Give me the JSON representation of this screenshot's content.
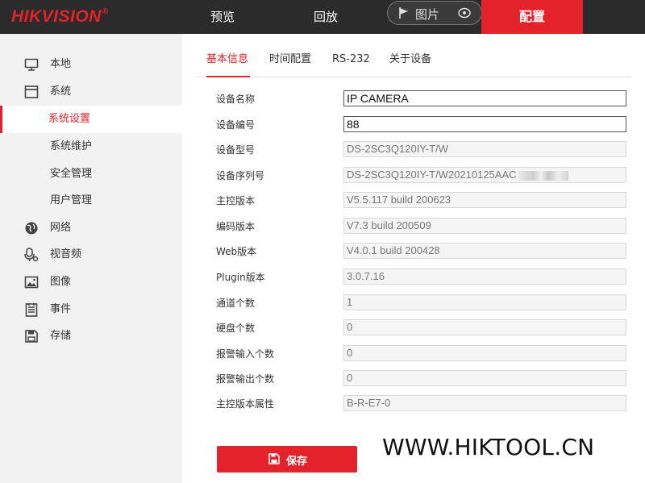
{
  "brand": {
    "logo_text": "HIKVISION",
    "reg_mark": "®"
  },
  "topnav": {
    "preview": "预览",
    "playback": "回放",
    "picture": "图片",
    "config": "配置"
  },
  "sidebar": {
    "items": [
      {
        "label": "本地",
        "icon": "monitor-icon"
      },
      {
        "label": "系统",
        "icon": "system-window-icon"
      },
      {
        "label": "系统设置",
        "active": true
      },
      {
        "label": "系统维护"
      },
      {
        "label": "安全管理"
      },
      {
        "label": "用户管理"
      },
      {
        "label": "网络",
        "icon": "globe-icon"
      },
      {
        "label": "视音频",
        "icon": "microphone-icon"
      },
      {
        "label": "图像",
        "icon": "image-icon"
      },
      {
        "label": "事件",
        "icon": "event-list-icon"
      },
      {
        "label": "存储",
        "icon": "save-disk-icon"
      }
    ]
  },
  "tabs": [
    {
      "label": "基本信息",
      "active": true
    },
    {
      "label": "时间配置"
    },
    {
      "label": "RS-232"
    },
    {
      "label": "关于设备"
    }
  ],
  "form": {
    "rows": [
      {
        "label": "设备名称",
        "value": "IP CAMERA",
        "editable": true
      },
      {
        "label": "设备编号",
        "value": "88",
        "editable": true
      },
      {
        "label": "设备型号",
        "value": "DS-2SC3Q120IY-T/W"
      },
      {
        "label": "设备序列号",
        "value": "DS-2SC3Q120IY-T/W20210125AAC"
      },
      {
        "label": "主控版本",
        "value": "V5.5.117 build 200623"
      },
      {
        "label": "编码版本",
        "value": "V7.3 build 200509"
      },
      {
        "label": "Web版本",
        "value": "V4.0.1 build 200428"
      },
      {
        "label": "Plugin版本",
        "value": "3.0.7.16"
      },
      {
        "label": "通道个数",
        "value": "1"
      },
      {
        "label": "硬盘个数",
        "value": "0"
      },
      {
        "label": "报警输入个数",
        "value": "0"
      },
      {
        "label": "报警输出个数",
        "value": "0"
      },
      {
        "label": "主控版本属性",
        "value": "B-R-E7-0"
      }
    ]
  },
  "save_label": "保存",
  "watermark": "WWW.HIKTOOL.CN",
  "colors": {
    "accent": "#e4222b",
    "topbar": "#2b2b2b",
    "sidebar": "#f2f2f2"
  }
}
